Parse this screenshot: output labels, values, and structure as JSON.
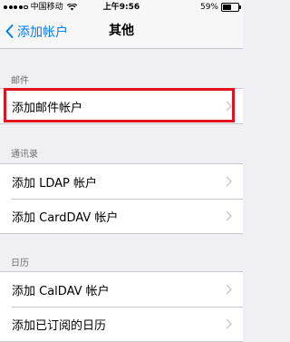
{
  "status_bar": {
    "carrier": "中国移动",
    "time": "上午9:56",
    "battery": "59%",
    "battery_level": 0.59
  },
  "nav": {
    "back_label": "添加帐户",
    "title": "其他"
  },
  "sections": [
    {
      "header": "邮件",
      "rows": [
        {
          "label": "添加邮件帐户"
        }
      ]
    },
    {
      "header": "通讯录",
      "rows": [
        {
          "label": "添加 LDAP 帐户"
        },
        {
          "label": "添加 CardDAV 帐户"
        }
      ]
    },
    {
      "header": "日历",
      "rows": [
        {
          "label": "添加 CalDAV 帐户"
        },
        {
          "label": "添加已订阅的日历"
        }
      ]
    }
  ],
  "icons": {
    "back": "chevron-left-icon",
    "disclosure": "chevron-right-icon",
    "wifi": "wifi-icon",
    "battery": "battery-icon"
  },
  "colors": {
    "accent": "#007aff",
    "highlight": "#e0141e",
    "background": "#efeff4"
  }
}
